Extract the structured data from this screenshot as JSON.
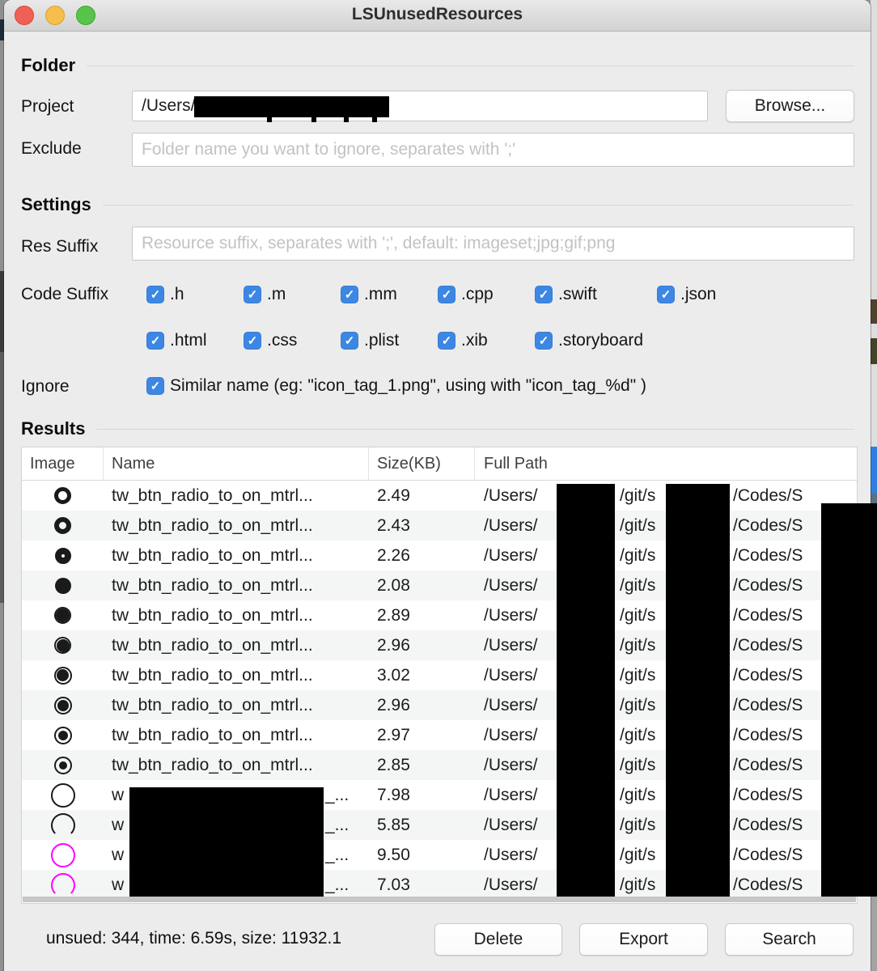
{
  "window": {
    "title": "LSUnusedResources"
  },
  "folder": {
    "header": "Folder",
    "project_label": "Project",
    "project_value": "/Users/",
    "browse_label": "Browse...",
    "exclude_label": "Exclude",
    "exclude_placeholder": "Folder name you want to ignore, separates with ';'"
  },
  "settings": {
    "header": "Settings",
    "res_suffix_label": "Res Suffix",
    "res_suffix_placeholder": "Resource suffix, separates with ';', default: imageset;jpg;gif;png",
    "code_suffix_label": "Code Suffix",
    "code_suffix_row1": [
      ".h",
      ".m",
      ".mm",
      ".cpp",
      ".swift",
      ".json"
    ],
    "code_suffix_row2": [
      ".html",
      ".css",
      ".plist",
      ".xib",
      ".storyboard"
    ],
    "all_code_suffix_checked": true,
    "ignore_label": "Ignore",
    "ignore_checked": true,
    "ignore_option": "Similar name (eg: \"icon_tag_1.png\", using with \"icon_tag_%d\" )"
  },
  "results": {
    "header": "Results",
    "columns": [
      "Image",
      "Name",
      "Size(KB)",
      "Full Path"
    ],
    "path_fragments": [
      "/Users/",
      "/git/s",
      "/Codes/S"
    ],
    "rows": [
      {
        "icon": {
          "kind": "ring",
          "size": 21,
          "border": 5,
          "color": "#1a1a1a"
        },
        "name": "tw_btn_radio_to_on_mtrl...",
        "size": "2.49"
      },
      {
        "icon": {
          "kind": "ring",
          "size": 21,
          "border": 6,
          "color": "#1a1a1a"
        },
        "name": "tw_btn_radio_to_on_mtrl...",
        "size": "2.43"
      },
      {
        "icon": {
          "kind": "ring",
          "size": 20,
          "border": 8,
          "color": "#1a1a1a"
        },
        "name": "tw_btn_radio_to_on_mtrl...",
        "size": "2.26"
      },
      {
        "icon": {
          "kind": "solid",
          "size": 20,
          "color": "#1a1a1a"
        },
        "name": "tw_btn_radio_to_on_mtrl...",
        "size": "2.08"
      },
      {
        "icon": {
          "kind": "dotring",
          "size": 21,
          "dot": 17,
          "color": "#1a1a1a"
        },
        "name": "tw_btn_radio_to_on_mtrl...",
        "size": "2.89"
      },
      {
        "icon": {
          "kind": "dotring",
          "size": 21,
          "dot": 16,
          "color": "#1a1a1a"
        },
        "name": "tw_btn_radio_to_on_mtrl...",
        "size": "2.96"
      },
      {
        "icon": {
          "kind": "dotring",
          "size": 22,
          "dot": 15,
          "color": "#1a1a1a"
        },
        "name": "tw_btn_radio_to_on_mtrl...",
        "size": "3.02"
      },
      {
        "icon": {
          "kind": "dotring",
          "size": 22,
          "dot": 14,
          "color": "#1a1a1a"
        },
        "name": "tw_btn_radio_to_on_mtrl...",
        "size": "2.96"
      },
      {
        "icon": {
          "kind": "dotring",
          "size": 22,
          "dot": 12,
          "color": "#1a1a1a"
        },
        "name": "tw_btn_radio_to_on_mtrl...",
        "size": "2.97"
      },
      {
        "icon": {
          "kind": "dotring",
          "size": 22,
          "dot": 10,
          "color": "#1a1a1a"
        },
        "name": "tw_btn_radio_to_on_mtrl...",
        "size": "2.85"
      },
      {
        "icon": {
          "kind": "circle",
          "size": 30,
          "color": "#1a1a1a"
        },
        "name_prefix": "w",
        "name_suffix": "_...",
        "redacted": true,
        "size": "7.98"
      },
      {
        "icon": {
          "kind": "arc",
          "size": 30,
          "color": "#1a1a1a"
        },
        "name_prefix": "w",
        "name_suffix": "_...",
        "redacted": true,
        "size": "5.85"
      },
      {
        "icon": {
          "kind": "circle",
          "size": 30,
          "color": "#ff00ff"
        },
        "name_prefix": "w",
        "name_suffix": "_...",
        "redacted": true,
        "size": "9.50"
      },
      {
        "icon": {
          "kind": "arc",
          "size": 30,
          "color": "#ff00ff"
        },
        "name_prefix": "w",
        "name_suffix": "_...",
        "redacted": true,
        "size": "7.03"
      }
    ]
  },
  "statusbar": {
    "status_text": "unsued: 344, time: 6.59s, size: 11932.1",
    "delete_label": "Delete",
    "export_label": "Export",
    "search_label": "Search"
  },
  "colors": {
    "checkbox_blue": "#3d87e4",
    "icon_black": "#1a1a1a",
    "icon_magenta": "#ff00ff"
  }
}
